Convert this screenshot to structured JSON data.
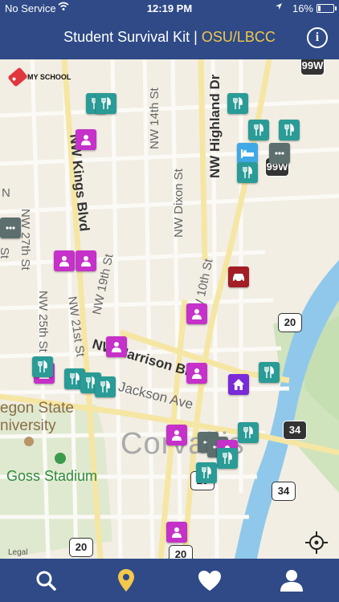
{
  "status_bar": {
    "carrier": "No Service",
    "time": "12:19 PM",
    "battery": "16%"
  },
  "nav": {
    "title_main": "Student Survival Kit | ",
    "title_accent": "OSU/LBCC",
    "info_icon": "info-icon",
    "info_label": "i"
  },
  "map": {
    "school_tag": "MY SCHOOL",
    "streets": {
      "nw_14th": "NW 14th St",
      "nw_highland": "NW Highland Dr",
      "nw_27th": "NW 27th St",
      "nw_kings": "NW Kings Blvd",
      "nw_dixon": "NW Dixon St",
      "nw_19th": "NW 19th St",
      "nw_10th": "NW 10th St",
      "nw_25th": "NW 25th St",
      "nw_21st": "NW 21st St",
      "nw_harrison": "NW Harrison Blvd",
      "jackson": "Jackson Ave",
      "nw_left": "N",
      "st_left": "St"
    },
    "places": {
      "university_line1": "egon State",
      "university_line2": "niversity",
      "stadium": "Goss Stadium",
      "city": "Corvallis"
    },
    "shields": [
      "99W",
      "99W",
      "20",
      "34",
      "34",
      "20",
      "20",
      "20"
    ],
    "legal": "Legal"
  },
  "tabs": [
    {
      "name": "search-tab",
      "icon": "search-icon"
    },
    {
      "name": "map-tab",
      "icon": "map-pin-icon"
    },
    {
      "name": "favorites-tab",
      "icon": "heart-icon"
    },
    {
      "name": "profile-tab",
      "icon": "user-icon"
    }
  ],
  "colors": {
    "bar": "#2f4a86",
    "accent": "#f3c84b",
    "active_tab": "#f3c84b",
    "food": "#2a9b96",
    "person": "#c531c9"
  }
}
